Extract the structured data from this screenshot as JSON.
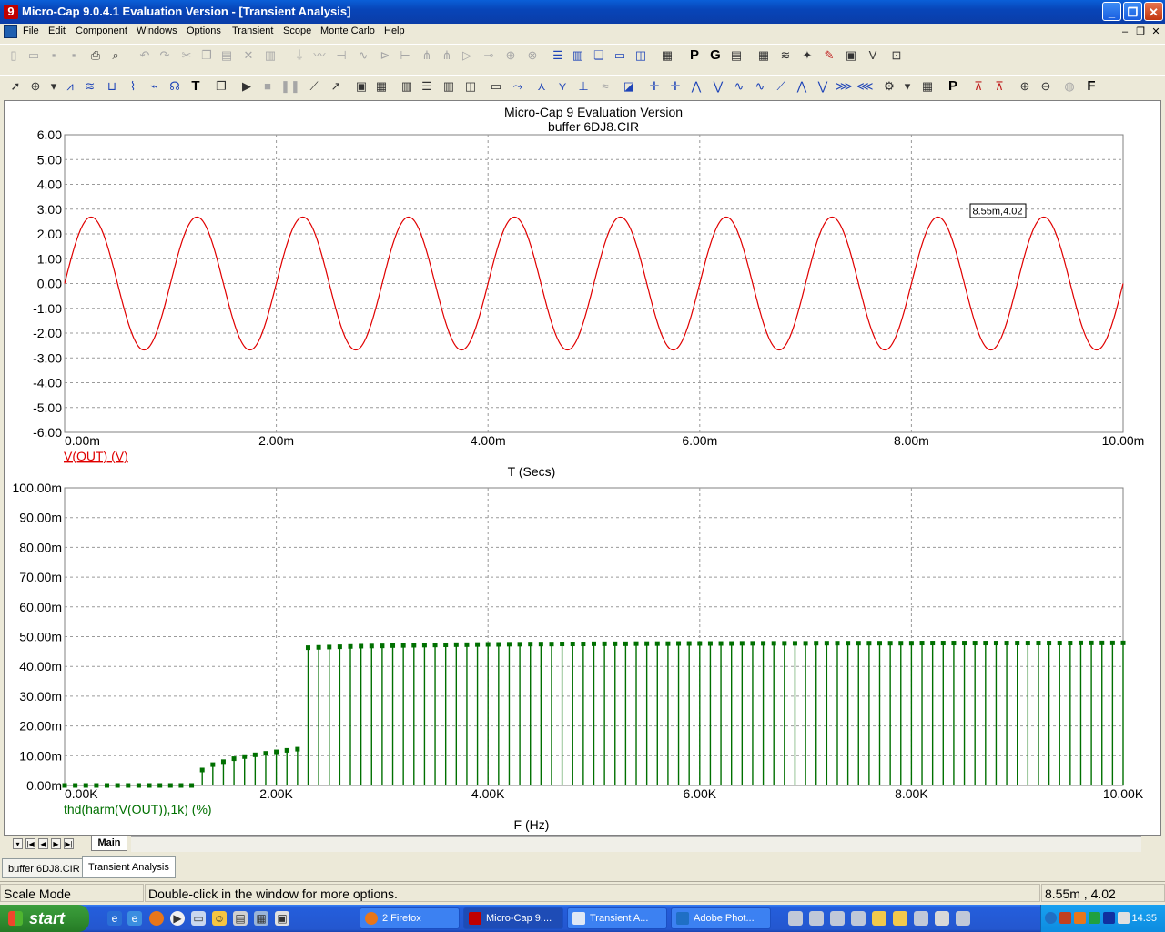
{
  "window": {
    "title": "Micro-Cap 9.0.4.1 Evaluation Version - [Transient Analysis]",
    "app_icon_glyph": "9"
  },
  "menu": {
    "items": [
      "File",
      "Edit",
      "Component",
      "Windows",
      "Options",
      "Transient",
      "Scope",
      "Monte Carlo",
      "Help"
    ]
  },
  "plot": {
    "header_line1": "Micro-Cap 9 Evaluation Version",
    "header_line2": "buffer 6DJ8.CIR",
    "cursor_tag": "8.55m,4.02"
  },
  "chart_data": [
    {
      "type": "line",
      "title": "",
      "series": [
        {
          "name": "V(OUT) (V)",
          "color": "#e00000",
          "amplitude": 2.68,
          "frequency_hz": 1000,
          "phase_cycles": 0
        }
      ],
      "x_range": [
        0,
        0.01
      ],
      "ylim": [
        -6,
        6
      ],
      "xlabel": "T (Secs)",
      "ylabel": "",
      "x_ticks": [
        "0.00m",
        "2.00m",
        "4.00m",
        "6.00m",
        "8.00m",
        "10.00m"
      ],
      "y_ticks": [
        "6.00",
        "5.00",
        "4.00",
        "3.00",
        "2.00",
        "1.00",
        "0.00",
        "-1.00",
        "-2.00",
        "-3.00",
        "-4.00",
        "-5.00",
        "-6.00"
      ],
      "grid": true,
      "cursor_point": [
        0.00855,
        4.02
      ]
    },
    {
      "type": "bar",
      "title": "",
      "series": [
        {
          "name": "thd(harm(V(OUT)),1k) (%)",
          "color": "#007000",
          "x": [
            0,
            100,
            200,
            300,
            400,
            500,
            600,
            700,
            800,
            900,
            1000,
            1100,
            1200,
            1300,
            1400,
            1500,
            1600,
            1700,
            1800,
            1900,
            2000,
            2100,
            2200,
            2300,
            2400,
            2500,
            2600,
            2700,
            2800,
            2900,
            3000,
            3100,
            3200,
            3300,
            3400,
            3500,
            3600,
            3700,
            3800,
            3900,
            4000,
            4100,
            4200,
            4300,
            4400,
            4500,
            4600,
            4700,
            4800,
            4900,
            5000,
            5100,
            5200,
            5300,
            5400,
            5500,
            5600,
            5700,
            5800,
            5900,
            6000,
            6100,
            6200,
            6300,
            6400,
            6500,
            6600,
            6700,
            6800,
            6900,
            7000,
            7100,
            7200,
            7300,
            7400,
            7500,
            7600,
            7700,
            7800,
            7900,
            8000,
            8100,
            8200,
            8300,
            8400,
            8500,
            8600,
            8700,
            8800,
            8900,
            9000,
            9100,
            9200,
            9300,
            9400,
            9500,
            9600,
            9700,
            9800,
            9900,
            10000
          ],
          "values": [
            0,
            0,
            0,
            0,
            0,
            0,
            0,
            0,
            0,
            0,
            0,
            0,
            0,
            5.2,
            7.0,
            8.0,
            9.0,
            9.7,
            10.3,
            10.8,
            11.3,
            11.8,
            12.2,
            46.3,
            46.4,
            46.5,
            46.6,
            46.7,
            46.8,
            46.85,
            46.9,
            47.0,
            47.05,
            47.1,
            47.15,
            47.2,
            47.25,
            47.3,
            47.3,
            47.35,
            47.4,
            47.4,
            47.45,
            47.45,
            47.5,
            47.5,
            47.5,
            47.55,
            47.55,
            47.55,
            47.6,
            47.6,
            47.6,
            47.6,
            47.65,
            47.65,
            47.65,
            47.65,
            47.7,
            47.7,
            47.7,
            47.7,
            47.7,
            47.7,
            47.75,
            47.75,
            47.75,
            47.75,
            47.75,
            47.75,
            47.75,
            47.8,
            47.8,
            47.8,
            47.8,
            47.8,
            47.8,
            47.8,
            47.8,
            47.8,
            47.8,
            47.85,
            47.85,
            47.85,
            47.85,
            47.85,
            47.85,
            47.85,
            47.85,
            47.85,
            47.85,
            47.85,
            47.85,
            47.85,
            47.85,
            47.85,
            47.9,
            47.9,
            47.9,
            47.9,
            47.9
          ]
        }
      ],
      "x_range": [
        0,
        10000
      ],
      "ylim": [
        0,
        100
      ],
      "xlabel": "F (Hz)",
      "ylabel": "",
      "x_ticks": [
        "0.00K",
        "2.00K",
        "4.00K",
        "6.00K",
        "8.00K",
        "10.00K"
      ],
      "y_ticks": [
        "100.00m",
        "90.00m",
        "80.00m",
        "70.00m",
        "60.00m",
        "50.00m",
        "40.00m",
        "30.00m",
        "20.00m",
        "10.00m",
        "0.00m"
      ],
      "grid": true
    }
  ],
  "pagetabs": {
    "main_label": "Main"
  },
  "doc_tabs": [
    "buffer 6DJ8.CIR",
    "Transient Analysis"
  ],
  "status": {
    "mode": "Scale Mode",
    "hint": "Double-click in the window for more options.",
    "coords": "8.55m , 4.02"
  },
  "taskbar": {
    "start_label": "start",
    "buttons": [
      "2 Firefox",
      "Micro-Cap 9....",
      "Transient A...",
      "Adobe Phot..."
    ],
    "clock": "14.35"
  }
}
